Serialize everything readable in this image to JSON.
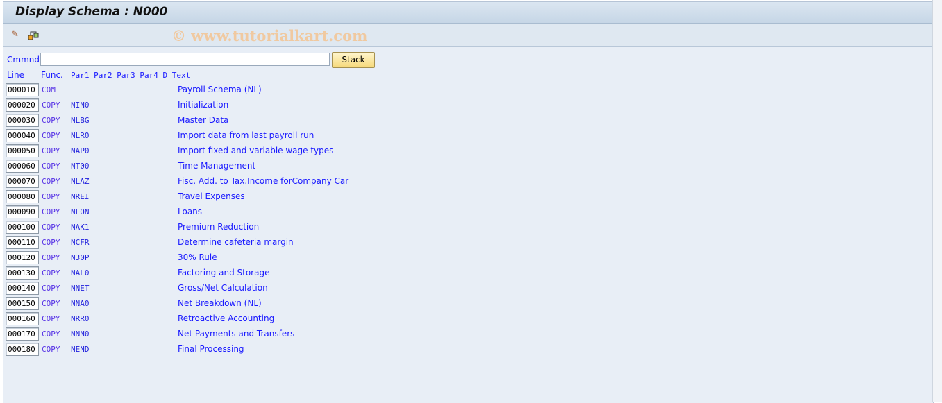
{
  "title": "Display Schema : N000",
  "toolbar": {
    "icons": [
      "change-pencil-icon",
      "hierarchy-icon"
    ],
    "watermark": "© www.tutorialkart.com"
  },
  "command": {
    "label": "Cmmnd",
    "value": "",
    "button": "Stack"
  },
  "headers": {
    "line": "Line",
    "func": "Func.",
    "par": "Par1 Par2 Par3 Par4 D Text"
  },
  "rows": [
    {
      "line": "000010",
      "func": "COM",
      "par1": "",
      "text": "Payroll Schema (NL)"
    },
    {
      "line": "000020",
      "func": "COPY",
      "par1": "NIN0",
      "text": "Initialization"
    },
    {
      "line": "000030",
      "func": "COPY",
      "par1": "NLBG",
      "text": "Master Data"
    },
    {
      "line": "000040",
      "func": "COPY",
      "par1": "NLR0",
      "text": "Import data from last payroll run"
    },
    {
      "line": "000050",
      "func": "COPY",
      "par1": "NAP0",
      "text": "Import fixed and variable wage types"
    },
    {
      "line": "000060",
      "func": "COPY",
      "par1": "NT00",
      "text": "Time Management"
    },
    {
      "line": "000070",
      "func": "COPY",
      "par1": "NLAZ",
      "text": "Fisc. Add. to Tax.Income forCompany Car"
    },
    {
      "line": "000080",
      "func": "COPY",
      "par1": "NREI",
      "text": "Travel Expenses"
    },
    {
      "line": "000090",
      "func": "COPY",
      "par1": "NLON",
      "text": "Loans"
    },
    {
      "line": "000100",
      "func": "COPY",
      "par1": "NAK1",
      "text": "Premium Reduction"
    },
    {
      "line": "000110",
      "func": "COPY",
      "par1": "NCFR",
      "text": "Determine cafeteria margin"
    },
    {
      "line": "000120",
      "func": "COPY",
      "par1": "N30P",
      "text": "30% Rule"
    },
    {
      "line": "000130",
      "func": "COPY",
      "par1": "NAL0",
      "text": "Factoring and Storage"
    },
    {
      "line": "000140",
      "func": "COPY",
      "par1": "NNET",
      "text": "Gross/Net Calculation"
    },
    {
      "line": "000150",
      "func": "COPY",
      "par1": "NNA0",
      "text": "Net Breakdown (NL)"
    },
    {
      "line": "000160",
      "func": "COPY",
      "par1": "NRR0",
      "text": "Retroactive Accounting"
    },
    {
      "line": "000170",
      "func": "COPY",
      "par1": "NNN0",
      "text": "Net Payments and Transfers"
    },
    {
      "line": "000180",
      "func": "COPY",
      "par1": "NEND",
      "text": "Final Processing"
    }
  ]
}
